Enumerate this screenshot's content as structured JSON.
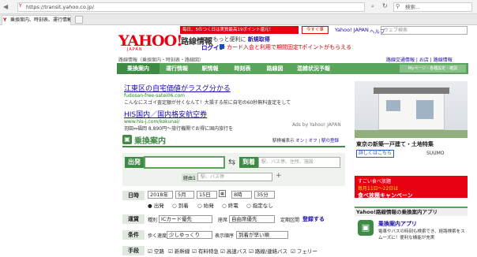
{
  "browser": {
    "url": "https://transit.yahoo.co.jp/",
    "search_placeholder": "検索...",
    "tab_title": "乗換案内、時刻表、運行情報 - ..."
  },
  "header": {
    "promo": "毎日、5のつく日は実質最高19ポイント還元！",
    "promo_btn": "今すぐ車",
    "yahoo_japan": "Yahoo! JAPAN",
    "help": "ヘルプ",
    "brand": "YAHOO!",
    "brand_sub": "JAPAN",
    "service": "路線情報",
    "login_prompt": "IDでもっと便利に",
    "signup": "新規取得",
    "login": "ログイン",
    "login_note": "カード入会と利用で期間固定Tポイントがもらえる",
    "breadcrumb": "路線情報（乗換案内・時刻表・路線図）",
    "top_links": [
      "路線交通情報",
      "お店",
      "路線情報"
    ]
  },
  "nav": [
    "乗換案内",
    "運行情報",
    "駅情報",
    "時刻表",
    "路線図",
    "混雑状況予報",
    "Myページ・各種設定・確認"
  ],
  "ads": [
    {
      "title": "江東区の自宅価値がラスグ分かる",
      "url": "fudosan-free-satei06.com",
      "desc": "こんなにスゴイ査定額が付くなんて！大損する前に自宅の60秒無料査定をして"
    },
    {
      "title": "HIS国内／国内格安航空券",
      "url": "www.his-j.com/kokunai/",
      "desc": "羽田⇔福岡 8,890円〜旅行機関でお得に国内旅行を"
    }
  ],
  "ads_by": "Ads by Yahoo! JAPAN",
  "form": {
    "title": "乗換案内",
    "from_label": "出発",
    "to_label": "到着",
    "to_placeholder": "駅、バス停、住所、施設",
    "via_label": "経由1",
    "via_placeholder": "駅、バス停",
    "top_links": [
      "駅検補表示",
      "オン",
      "オフ",
      "駅の登録"
    ],
    "date_label": "日時",
    "year": "2018年",
    "month": "5月",
    "day": "15日",
    "hour": "8時",
    "minute": "35分",
    "time_options": [
      "出発",
      "到着",
      "始発",
      "終電",
      "指定なし"
    ],
    "fare_label": "運賃",
    "ticket_label": "種別",
    "ticket_value": "ICカード優先",
    "seat_label": "座席",
    "seat_value": "自由席優先",
    "commuter_label": "定期区間",
    "commuter_link": "登録する",
    "cond_label": "条件",
    "walk_label": "歩く速度",
    "walk_value": "少しゆっくり",
    "sort_label": "表示順序",
    "sort_value": "到着が早い順",
    "means_label": "手段",
    "means": [
      "空路",
      "新幹線",
      "有料特急",
      "高速バス",
      "路線/連絡バス",
      "フェリー"
    ]
  },
  "right": {
    "house_caption": "東京の新築一戸建て・土地特集",
    "house_btn": "詳しくはこちら",
    "house_brand": "SUUMO",
    "banner_text1": "すごい食べ放題",
    "banner_text2": "毎月11日〜22日は",
    "banner_text3": "食べ放題キャンペーン",
    "app_section": "Yahoo!路線情報の乗換案内アプリ",
    "app_title": "乗換案内アプリ",
    "app_desc": "電車やバスの時刻も検索でき、経路検索をスムーズに！便利な機能が充実"
  }
}
